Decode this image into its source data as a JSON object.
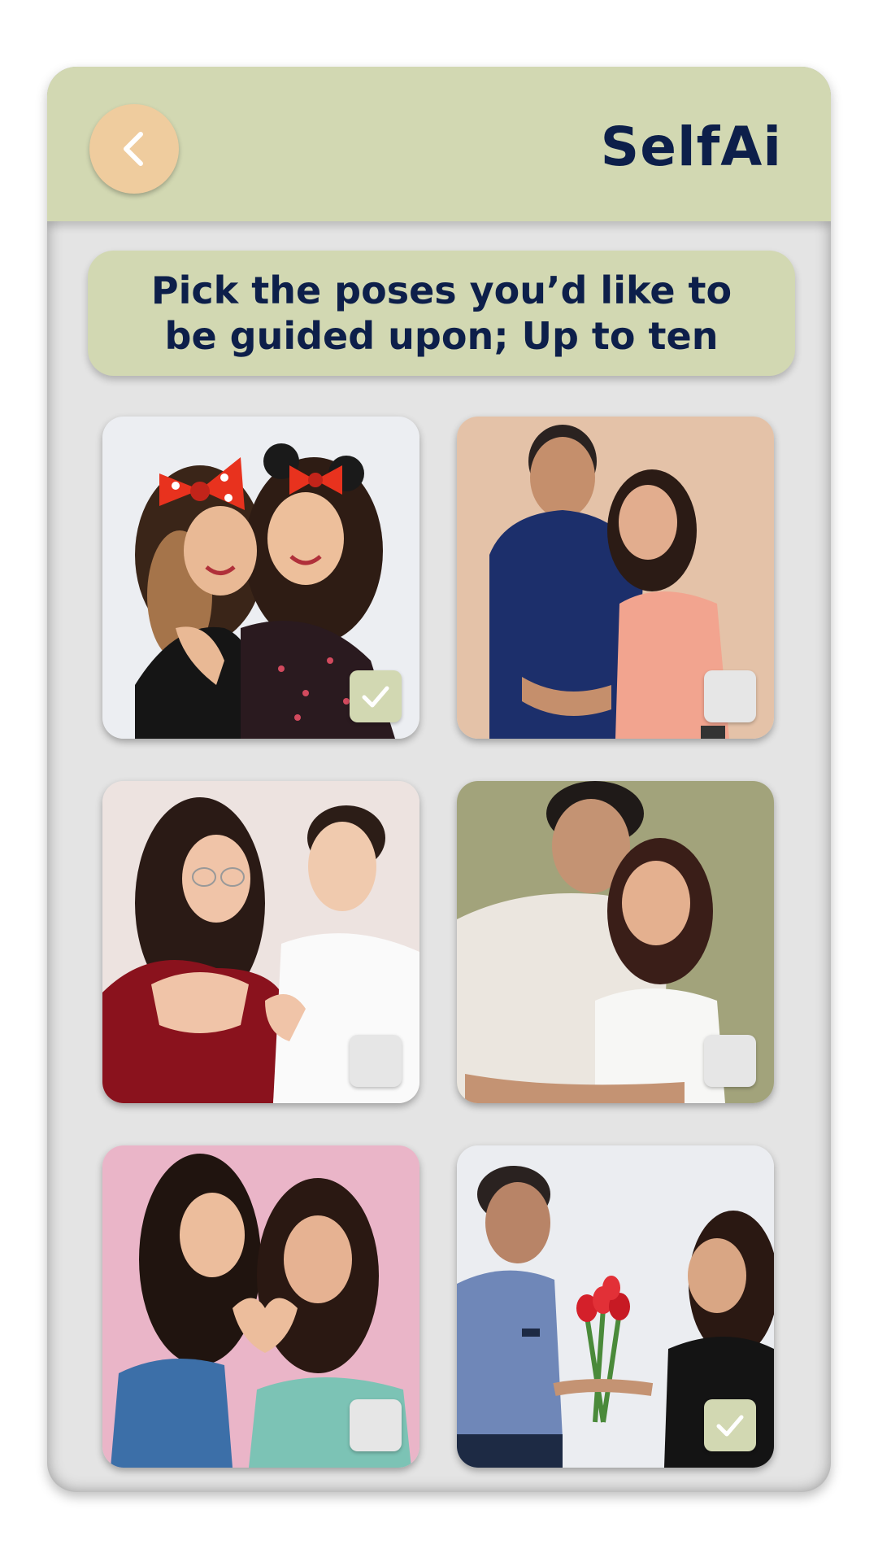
{
  "header": {
    "title": "SelfAi",
    "back_icon": "chevron-left-icon"
  },
  "instruction": {
    "line1": "Pick the poses you’d like to",
    "line2": "be guided upon; Up to ten"
  },
  "colors": {
    "header_bg": "#d2d8b2",
    "back_button_bg": "#efcc9e",
    "title_text": "#0d1f4a",
    "screen_bg": "#e4e4e4",
    "checkbox_checked": "#d2d8b2",
    "checkbox_unchecked": "#e6e6e6"
  },
  "poses": [
    {
      "id": "pose-1",
      "checked": true
    },
    {
      "id": "pose-2",
      "checked": false
    },
    {
      "id": "pose-3",
      "checked": false
    },
    {
      "id": "pose-4",
      "checked": false
    },
    {
      "id": "pose-5",
      "checked": false
    },
    {
      "id": "pose-6",
      "checked": true
    }
  ]
}
